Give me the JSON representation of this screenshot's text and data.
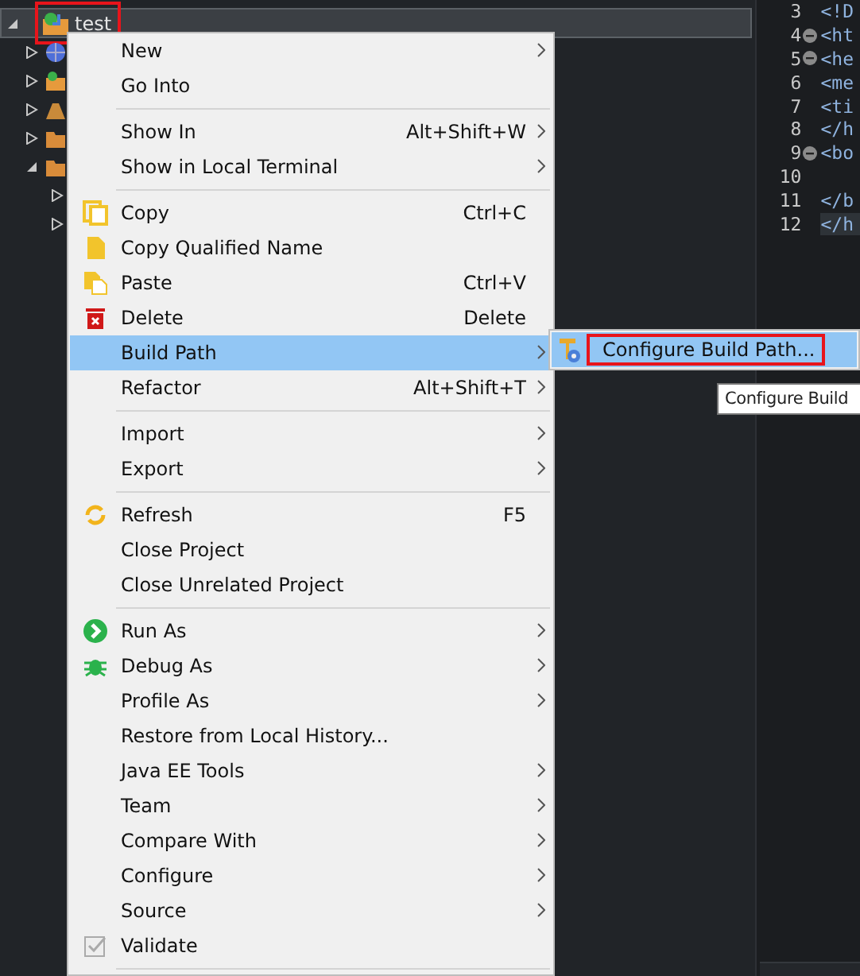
{
  "explorer": {
    "root": {
      "label": "test",
      "selected": true,
      "expanded": true,
      "annotated": true,
      "children": [
        {
          "kind": "web",
          "expanded": false
        },
        {
          "kind": "project",
          "expanded": false
        },
        {
          "kind": "library",
          "expanded": false
        },
        {
          "kind": "folder",
          "expanded": false
        },
        {
          "kind": "folder",
          "expanded": true,
          "children": [
            {
              "expanded": false
            },
            {
              "expanded": false
            }
          ]
        }
      ]
    }
  },
  "context_menu": {
    "groups": [
      [
        {
          "label": "New",
          "submenu": true,
          "selected": false
        },
        {
          "label": "Go Into",
          "submenu": false,
          "selected": false
        }
      ],
      [
        {
          "label": "Show In",
          "shortcut": "Alt+Shift+W",
          "submenu": true,
          "selected": false
        },
        {
          "label": "Show in Local Terminal",
          "submenu": true,
          "selected": false
        }
      ],
      [
        {
          "label": "Copy",
          "shortcut": "Ctrl+C",
          "kind": "copy",
          "submenu": false,
          "selected": false
        },
        {
          "label": "Copy Qualified Name",
          "kind": "page",
          "submenu": false,
          "selected": false
        },
        {
          "label": "Paste",
          "shortcut": "Ctrl+V",
          "kind": "paste",
          "submenu": false,
          "selected": false
        },
        {
          "label": "Delete",
          "shortcut": "Delete",
          "kind": "delete",
          "submenu": false,
          "selected": false
        },
        {
          "label": "Build Path",
          "submenu": true,
          "selected": true
        },
        {
          "label": "Refactor",
          "shortcut": "Alt+Shift+T",
          "submenu": true,
          "selected": false
        }
      ],
      [
        {
          "label": "Import",
          "submenu": true,
          "selected": false
        },
        {
          "label": "Export",
          "submenu": true,
          "selected": false
        }
      ],
      [
        {
          "label": "Refresh",
          "shortcut": "F5",
          "kind": "refresh",
          "submenu": false,
          "selected": false
        },
        {
          "label": "Close Project",
          "submenu": false,
          "selected": false
        },
        {
          "label": "Close Unrelated Project",
          "submenu": false,
          "selected": false
        }
      ],
      [
        {
          "label": "Run As",
          "kind": "run",
          "submenu": true,
          "selected": false
        },
        {
          "label": "Debug As",
          "kind": "bug",
          "submenu": true,
          "selected": false
        },
        {
          "label": "Profile As",
          "submenu": true,
          "selected": false
        },
        {
          "label": "Restore from Local History...",
          "submenu": false,
          "selected": false
        },
        {
          "label": "Java EE Tools",
          "submenu": true,
          "selected": false
        },
        {
          "label": "Team",
          "submenu": true,
          "selected": false
        },
        {
          "label": "Compare With",
          "submenu": true,
          "selected": false
        },
        {
          "label": "Configure",
          "submenu": true,
          "selected": false
        },
        {
          "label": "Source",
          "submenu": true,
          "selected": false
        },
        {
          "label": "Validate",
          "kind": "validate",
          "submenu": false,
          "selected": false
        }
      ]
    ]
  },
  "submenu": {
    "items": [
      {
        "label": "Configure Build Path...",
        "kind": "build",
        "selected": true,
        "annotated": true
      }
    ]
  },
  "tooltip": "Configure Build",
  "editor": {
    "lines": [
      {
        "number": "3",
        "code": "<!D"
      },
      {
        "number": "4",
        "code": "<ht",
        "foldable": true
      },
      {
        "number": "5",
        "code": "<he",
        "foldable": true
      },
      {
        "number": "6",
        "code": "<me"
      },
      {
        "number": "7",
        "code": "<ti"
      },
      {
        "number": "8",
        "code": "</h"
      },
      {
        "number": "9",
        "code": "<bo",
        "foldable": true
      },
      {
        "number": "10"
      },
      {
        "number": "11",
        "code": "</b"
      },
      {
        "number": "12",
        "code": "</h",
        "current": true
      }
    ]
  }
}
